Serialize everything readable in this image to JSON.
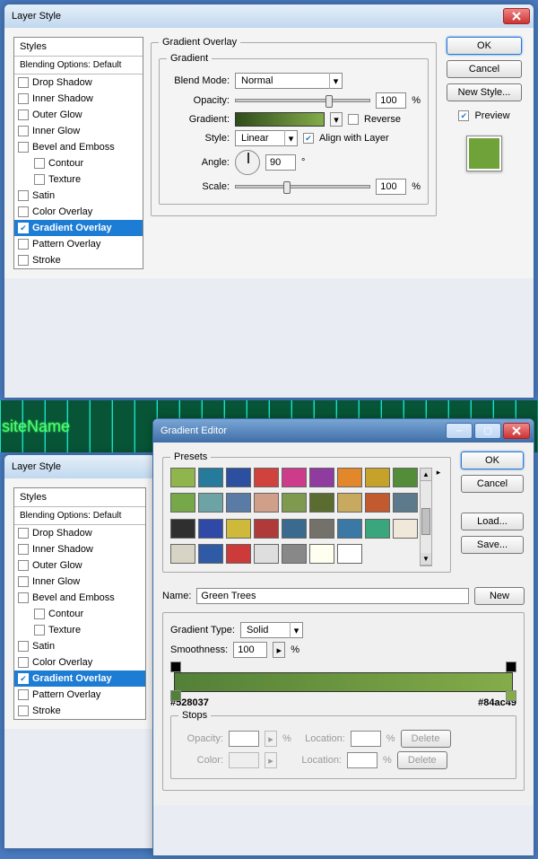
{
  "layerStyle1": {
    "title": "Layer Style",
    "stylesHeader": "Styles",
    "blendingDefault": "Blending Options: Default",
    "items": [
      "Drop Shadow",
      "Inner Shadow",
      "Outer Glow",
      "Inner Glow",
      "Bevel and Emboss",
      "Contour",
      "Texture",
      "Satin",
      "Color Overlay",
      "Gradient Overlay",
      "Pattern Overlay",
      "Stroke"
    ],
    "section": "Gradient Overlay",
    "gradientLegend": "Gradient",
    "blendModeLabel": "Blend Mode:",
    "blendModeValue": "Normal",
    "opacityLabel": "Opacity:",
    "opacityValue": "100",
    "percent": "%",
    "gradientLabel": "Gradient:",
    "reverseLabel": "Reverse",
    "styleLabel": "Style:",
    "styleValue": "Linear",
    "alignLabel": "Align with Layer",
    "angleLabel": "Angle:",
    "angleValue": "90",
    "degree": "°",
    "scaleLabel": "Scale:",
    "scaleValue": "100",
    "okLabel": "OK",
    "cancelLabel": "Cancel",
    "newStyleLabel": "New Style...",
    "previewLabel": "Preview"
  },
  "strip": {
    "text": "siteName"
  },
  "layerStyle2": {
    "title": "Layer Style"
  },
  "gradientEditor": {
    "title": "Gradient Editor",
    "presetsLabel": "Presets",
    "nameLabel": "Name:",
    "nameValue": "Green Trees",
    "newLabel": "New",
    "gradTypeLabel": "Gradient Type:",
    "gradTypeValue": "Solid",
    "smoothLabel": "Smoothness:",
    "smoothValue": "100",
    "percent": "%",
    "leftColor": "#528037",
    "rightColor": "#84ac49",
    "stopsLabel": "Stops",
    "opacityLabel": "Opacity:",
    "locationLabel": "Location:",
    "colorLabel": "Color:",
    "deleteLabel": "Delete",
    "okLabel": "OK",
    "cancelLabel": "Cancel",
    "loadLabel": "Load...",
    "saveLabel": "Save...",
    "presetColors": [
      "#8fb54c",
      "#267a9b",
      "#2d4fa0",
      "#d0423d",
      "#cc3c8a",
      "#8f3ba0",
      "#e3872b",
      "#c6a22b",
      "#548d3a",
      "#76a748",
      "#6da3a5",
      "#5a7ba5",
      "#cf9f8a",
      "#7d9a4f",
      "#5a6c2f",
      "#c7a95f",
      "#c15a2f",
      "#5d7a8d",
      "#2f2f2f",
      "#2f4aa6",
      "#cfb93a",
      "#b03a3a",
      "#3a6a8d",
      "#74706a",
      "#3a78a6",
      "#3aa67d",
      "#f0e8d8",
      "#d7d4c6",
      "#2f5aa6",
      "#cc3a3a",
      "#dedede",
      "#888888",
      "#fffff0",
      "#fff"
    ]
  }
}
